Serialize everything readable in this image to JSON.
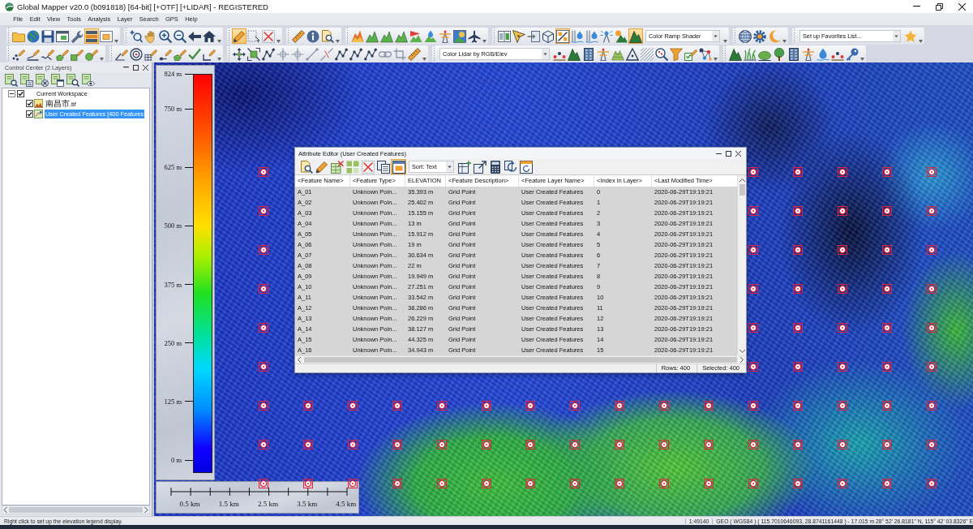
{
  "window": {
    "title": "Global Mapper v20.0 (b091818) [64-bit] [+OTF] [+LIDAR] - REGISTERED"
  },
  "menu": [
    "File",
    "Edit",
    "View",
    "Tools",
    "Analysis",
    "Layer",
    "Search",
    "GPS",
    "Help"
  ],
  "toolbar_rows": [
    {
      "groups": [
        {
          "items": [
            {
              "kind": "button",
              "selected": false
            },
            {
              "kind": "button",
              "selected": false
            },
            {
              "kind": "button",
              "selected": false
            },
            {
              "kind": "button",
              "selected": false
            },
            {
              "kind": "button",
              "selected": false
            },
            {
              "kind": "button",
              "selected": true
            },
            {
              "kind": "button",
              "selected": false
            }
          ]
        },
        {
          "items": [
            {
              "kind": "button",
              "selected": false
            },
            {
              "kind": "button",
              "selected": false
            },
            {
              "kind": "button",
              "selected": false
            },
            {
              "kind": "button",
              "selected": false
            },
            {
              "kind": "button",
              "selected": false
            },
            {
              "kind": "button",
              "selected": false
            }
          ]
        },
        {
          "items": [
            {
              "kind": "button",
              "selected": true
            },
            {
              "kind": "button",
              "selected": false
            },
            {
              "kind": "button",
              "selected": false
            }
          ]
        },
        {
          "items": [
            {
              "kind": "button",
              "selected": false
            },
            {
              "kind": "button",
              "selected": false
            },
            {
              "kind": "button",
              "selected": false
            }
          ]
        },
        {
          "items": [
            {
              "kind": "button",
              "selected": false
            },
            {
              "kind": "button",
              "selected": false
            },
            {
              "kind": "button",
              "selected": false
            },
            {
              "kind": "button",
              "selected": false
            },
            {
              "kind": "button",
              "selected": false
            },
            {
              "kind": "button",
              "selected": false
            },
            {
              "kind": "button",
              "selected": false
            },
            {
              "kind": "button",
              "selected": false
            },
            {
              "kind": "button",
              "selected": false
            }
          ]
        },
        {
          "items": [
            {
              "kind": "button",
              "selected": false
            },
            {
              "kind": "button",
              "selected": false
            },
            {
              "kind": "button",
              "selected": false
            },
            {
              "kind": "button",
              "selected": false
            },
            {
              "kind": "button",
              "selected": true
            },
            {
              "kind": "button",
              "selected": false
            },
            {
              "kind": "button",
              "selected": false
            },
            {
              "kind": "button",
              "selected": false
            },
            {
              "kind": "button",
              "selected": false
            },
            {
              "kind": "button",
              "selected": true
            },
            {
              "kind": "dropdown",
              "value": "Color Ramp Shader"
            }
          ]
        },
        {
          "items": [
            {
              "kind": "button",
              "selected": false
            },
            {
              "kind": "button",
              "selected": false
            },
            {
              "kind": "button",
              "selected": false
            }
          ]
        },
        {
          "items": [
            {
              "kind": "dropdown",
              "value": "Set up Favorites List..."
            },
            {
              "kind": "button",
              "selected": false
            }
          ]
        }
      ]
    },
    {
      "groups": [
        {
          "items": [
            {
              "kind": "button",
              "selected": false
            },
            {
              "kind": "button",
              "selected": false
            },
            {
              "kind": "button",
              "selected": false
            },
            {
              "kind": "button",
              "selected": false
            },
            {
              "kind": "button",
              "selected": false
            },
            {
              "kind": "button",
              "selected": false
            }
          ]
        },
        {
          "items": [
            {
              "kind": "button",
              "selected": false
            },
            {
              "kind": "button",
              "selected": false
            },
            {
              "kind": "button",
              "selected": false
            },
            {
              "kind": "button",
              "selected": false
            },
            {
              "kind": "button",
              "selected": false
            },
            {
              "kind": "button",
              "selected": false
            },
            {
              "kind": "button",
              "selected": false
            }
          ]
        },
        {
          "items": [
            {
              "kind": "button",
              "selected": false
            },
            {
              "kind": "button",
              "selected": false
            },
            {
              "kind": "button",
              "selected": false
            },
            {
              "kind": "button",
              "selected": false
            },
            {
              "kind": "button",
              "selected": false
            },
            {
              "kind": "button",
              "selected": false
            },
            {
              "kind": "button",
              "selected": false
            },
            {
              "kind": "button",
              "selected": false
            },
            {
              "kind": "button",
              "selected": false
            },
            {
              "kind": "button",
              "selected": false
            },
            {
              "kind": "button",
              "selected": false
            },
            {
              "kind": "button",
              "selected": false
            },
            {
              "kind": "button",
              "selected": false
            }
          ]
        },
        {
          "items": [
            {
              "kind": "dropdown",
              "value": "Color Lidar by RGB/Elev"
            },
            {
              "kind": "button",
              "selected": false
            },
            {
              "kind": "button",
              "selected": false
            },
            {
              "kind": "button",
              "selected": false
            },
            {
              "kind": "button",
              "selected": false
            },
            {
              "kind": "button",
              "selected": false
            },
            {
              "kind": "button",
              "selected": false
            },
            {
              "kind": "button",
              "selected": false
            },
            {
              "kind": "button",
              "selected": false
            },
            {
              "kind": "button",
              "selected": false
            },
            {
              "kind": "button",
              "selected": false
            },
            {
              "kind": "button",
              "selected": false
            }
          ]
        },
        {
          "items": [
            {
              "kind": "button",
              "selected": false
            },
            {
              "kind": "button",
              "selected": false
            },
            {
              "kind": "button",
              "selected": false
            },
            {
              "kind": "button",
              "selected": false
            },
            {
              "kind": "button",
              "selected": false
            },
            {
              "kind": "button",
              "selected": false
            },
            {
              "kind": "button",
              "selected": false
            },
            {
              "kind": "button",
              "selected": false
            },
            {
              "kind": "button",
              "selected": false
            }
          ]
        }
      ]
    }
  ],
  "control_center": {
    "title": "Control Center (2 Layers)",
    "tree": [
      {
        "label": "Current Workspace",
        "checked": true,
        "expanded": true,
        "selected": false,
        "children": [
          {
            "label": "南昌市.tif",
            "kind": "raster",
            "checked": true,
            "selected": false
          },
          {
            "label": "User Created Features [400 Features",
            "kind": "vector",
            "checked": true,
            "selected": true
          }
        ]
      }
    ]
  },
  "map": {
    "legend": {
      "labels": [
        "824 m",
        "750 m",
        "625 m",
        "500 m",
        "375 m",
        "250 m",
        "125 m",
        "0 m"
      ]
    },
    "scale_bar": {
      "labels": [
        "0.5 km",
        "1.5 km",
        "2.5 km",
        "3.5 km",
        "4.5 km"
      ]
    }
  },
  "attribute_editor": {
    "title": "Attribute Editor (User Created Features)",
    "toolbar": [
      {
        "kind": "button",
        "selected": false
      },
      {
        "kind": "button",
        "selected": false
      },
      {
        "kind": "button",
        "selected": false
      },
      {
        "kind": "button",
        "selected": false
      },
      {
        "kind": "button",
        "selected": false
      },
      {
        "kind": "button",
        "selected": false
      },
      {
        "kind": "button",
        "selected": true
      },
      {
        "kind": "dropdown",
        "value": "Sort: Text"
      },
      {
        "kind": "button",
        "selected": false
      },
      {
        "kind": "button",
        "selected": false
      },
      {
        "kind": "button",
        "selected": false
      },
      {
        "kind": "button",
        "selected": false
      },
      {
        "kind": "button",
        "selected": false
      }
    ],
    "columns": [
      "<Feature Name>",
      "<Feature Type>",
      "ELEVATION",
      "<Feature Description>",
      "<Feature Layer Name>",
      "<Index in Layer>",
      "<Last Modified Time>"
    ],
    "rows": [
      {
        "cells": [
          "A_01",
          "Unknown Poin...",
          "35.393 m",
          "Grid Point",
          "User Created Features",
          "0",
          "2020-06-29T19:19:21"
        ],
        "selected": true
      },
      {
        "cells": [
          "A_02",
          "Unknown Poin...",
          "25.402 m",
          "Grid Point",
          "User Created Features",
          "1",
          "2020-06-29T19:19:21"
        ],
        "selected": true
      },
      {
        "cells": [
          "A_03",
          "Unknown Poin...",
          "15.155 m",
          "Grid Point",
          "User Created Features",
          "2",
          "2020-06-29T19:19:21"
        ],
        "selected": true
      },
      {
        "cells": [
          "A_04",
          "Unknown Poin...",
          "13 m",
          "Grid Point",
          "User Created Features",
          "3",
          "2020-06-29T19:19:21"
        ],
        "selected": true
      },
      {
        "cells": [
          "A_05",
          "Unknown Poin...",
          "15.912 m",
          "Grid Point",
          "User Created Features",
          "4",
          "2020-06-29T19:19:21"
        ],
        "selected": true
      },
      {
        "cells": [
          "A_06",
          "Unknown Poin...",
          "19 m",
          "Grid Point",
          "User Created Features",
          "5",
          "2020-06-29T19:19:21"
        ],
        "selected": true
      },
      {
        "cells": [
          "A_07",
          "Unknown Poin...",
          "30.634 m",
          "Grid Point",
          "User Created Features",
          "6",
          "2020-06-29T19:19:21"
        ],
        "selected": true
      },
      {
        "cells": [
          "A_08",
          "Unknown Poin...",
          "22 m",
          "Grid Point",
          "User Created Features",
          "7",
          "2020-06-29T19:19:21"
        ],
        "selected": true
      },
      {
        "cells": [
          "A_09",
          "Unknown Poin...",
          "19.949 m",
          "Grid Point",
          "User Created Features",
          "8",
          "2020-06-29T19:19:21"
        ],
        "selected": true
      },
      {
        "cells": [
          "A_10",
          "Unknown Poin...",
          "27.251 m",
          "Grid Point",
          "User Created Features",
          "9",
          "2020-06-29T19:19:21"
        ],
        "selected": true
      },
      {
        "cells": [
          "A_11",
          "Unknown Poin...",
          "33.542 m",
          "Grid Point",
          "User Created Features",
          "10",
          "2020-06-29T19:19:21"
        ],
        "selected": true
      },
      {
        "cells": [
          "A_12",
          "Unknown Poin...",
          "38.286 m",
          "Grid Point",
          "User Created Features",
          "11",
          "2020-06-29T19:19:21"
        ],
        "selected": true
      },
      {
        "cells": [
          "A_13",
          "Unknown Poin...",
          "26.229 m",
          "Grid Point",
          "User Created Features",
          "12",
          "2020-06-29T19:19:21"
        ],
        "selected": true
      },
      {
        "cells": [
          "A_14",
          "Unknown Poin...",
          "38.127 m",
          "Grid Point",
          "User Created Features",
          "13",
          "2020-06-29T19:19:21"
        ],
        "selected": true
      },
      {
        "cells": [
          "A_15",
          "Unknown Poin...",
          "44.325 m",
          "Grid Point",
          "User Created Features",
          "14",
          "2020-06-29T19:19:21"
        ],
        "selected": true
      },
      {
        "cells": [
          "A_16",
          "Unknown Poin...",
          "34.943 m",
          "Grid Point",
          "User Created Features",
          "15",
          "2020-06-29T19:19:21"
        ],
        "selected": true
      }
    ],
    "status": {
      "rows": "Rows: 400",
      "selected": "Selected: 400"
    }
  },
  "status_bar": {
    "hint": "Right click to set up the elevation legend display.",
    "scale": "1:49140",
    "position": "GEO ( WGS84 ) ( 115.7010646093, 28.8741161448 ) - 17.015 m 28° 52' 26.8181\" N, 115° 42' 03.8326\" E"
  }
}
